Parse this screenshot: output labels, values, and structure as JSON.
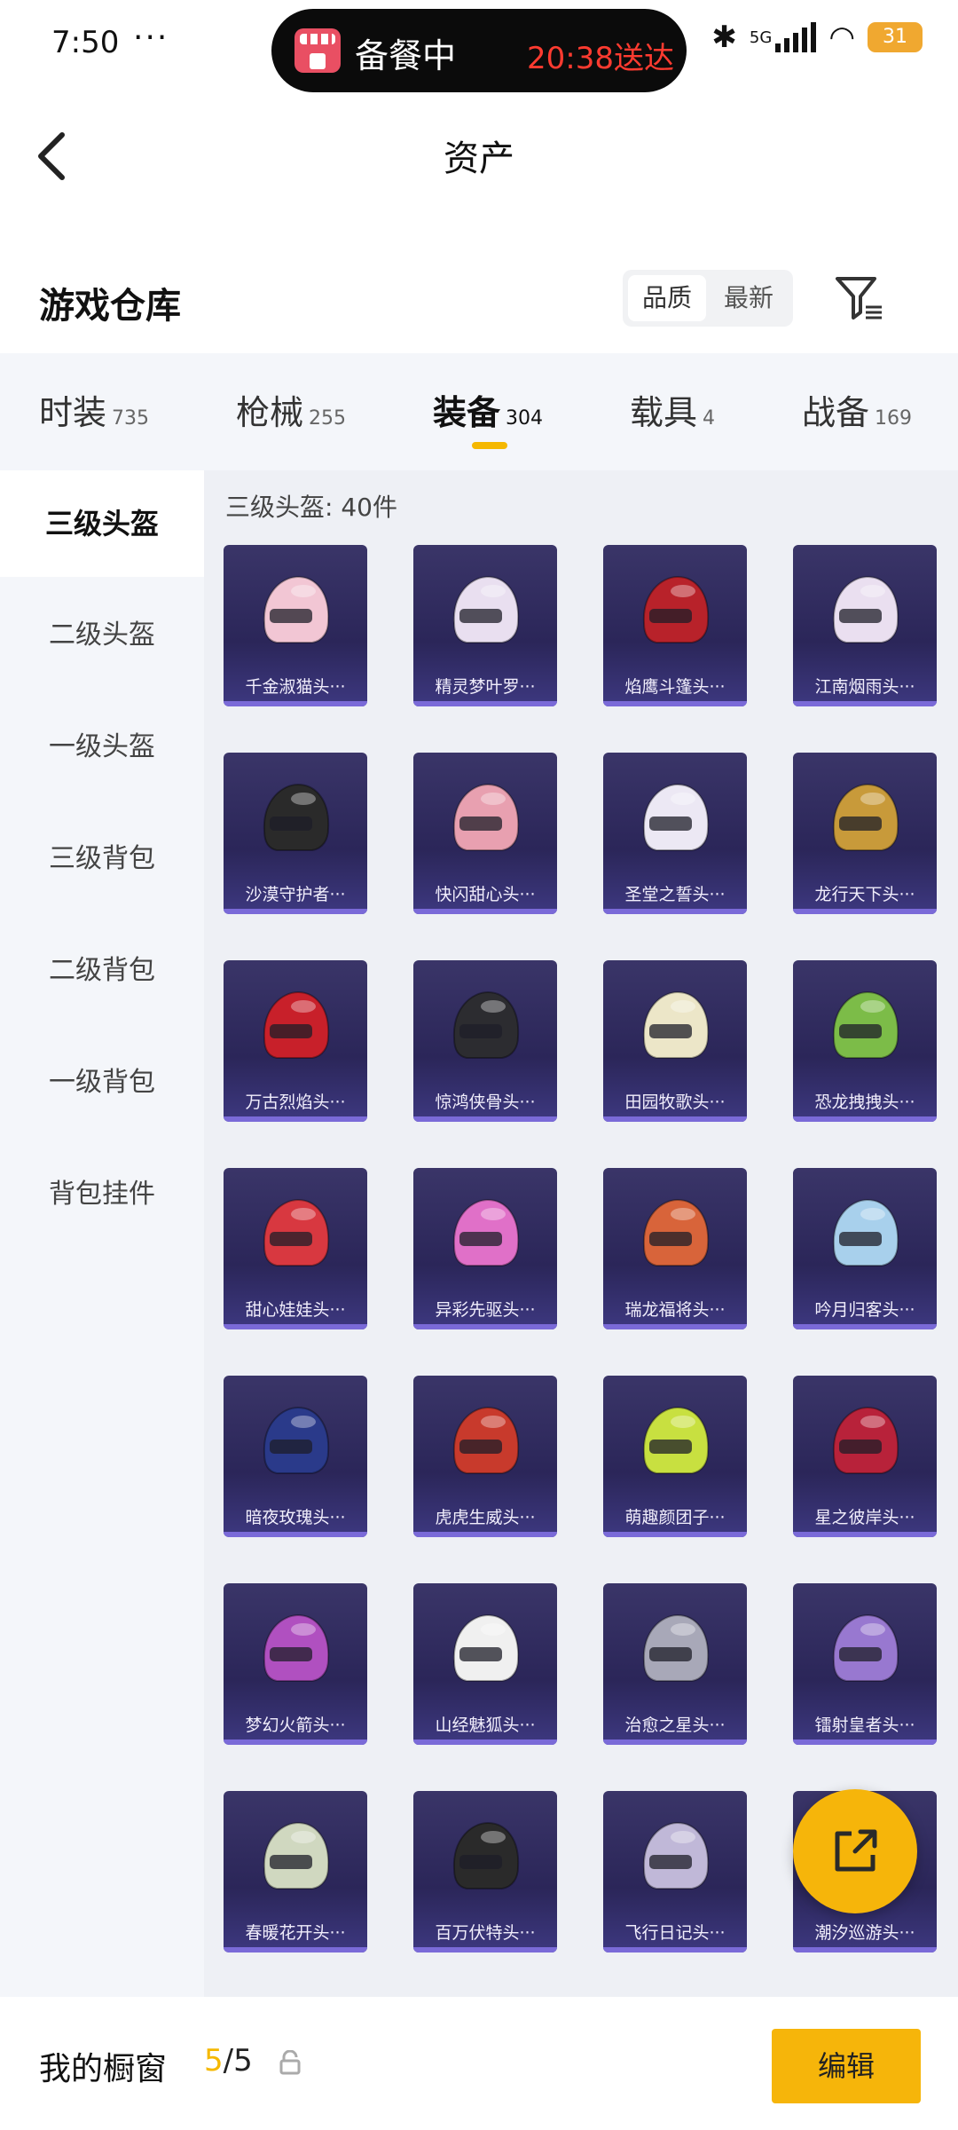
{
  "status_bar": {
    "time": "7:50",
    "dots": "···",
    "island_text": "备餐中",
    "island_time": "20:38送达",
    "network": "5G",
    "battery": "31"
  },
  "nav": {
    "title": "资产"
  },
  "header": {
    "title": "游戏仓库",
    "sort_quality": "品质",
    "sort_newest": "最新"
  },
  "tabs": [
    {
      "label": "时装",
      "count": "735"
    },
    {
      "label": "枪械",
      "count": "255"
    },
    {
      "label": "装备",
      "count": "304"
    },
    {
      "label": "载具",
      "count": "4"
    },
    {
      "label": "战备",
      "count": "169"
    }
  ],
  "sidebar": [
    {
      "label": "三级头盔"
    },
    {
      "label": "二级头盔"
    },
    {
      "label": "一级头盔"
    },
    {
      "label": "三级背包"
    },
    {
      "label": "二级背包"
    },
    {
      "label": "一级背包"
    },
    {
      "label": "背包挂件"
    }
  ],
  "subcat_count": "三级头盔: 40件",
  "items": [
    {
      "name": "千金淑猫头···",
      "color": "#f2c6d4"
    },
    {
      "name": "精灵梦叶罗···",
      "color": "#e9dff0"
    },
    {
      "name": "焰鹰斗篷头···",
      "color": "#b8222a"
    },
    {
      "name": "江南烟雨头···",
      "color": "#eadff0"
    },
    {
      "name": "沙漠守护者···",
      "color": "#2a2a2a"
    },
    {
      "name": "快闪甜心头···",
      "color": "#e8a0b0"
    },
    {
      "name": "圣堂之誓头···",
      "color": "#ece8f4"
    },
    {
      "name": "龙行天下头···",
      "color": "#c89a3a"
    },
    {
      "name": "万古烈焰头···",
      "color": "#c8202a"
    },
    {
      "name": "惊鸿侠骨头···",
      "color": "#2c2c30"
    },
    {
      "name": "田园牧歌头···",
      "color": "#ece6c8"
    },
    {
      "name": "恐龙拽拽头···",
      "color": "#7cbc48"
    },
    {
      "name": "甜心娃娃头···",
      "color": "#d83840"
    },
    {
      "name": "异彩先驱头···",
      "color": "#e070c8"
    },
    {
      "name": "瑞龙福将头···",
      "color": "#d8643a"
    },
    {
      "name": "吟月归客头···",
      "color": "#a8d0ec"
    },
    {
      "name": "暗夜玫瑰头···",
      "color": "#2a3a8a"
    },
    {
      "name": "虎虎生威头···",
      "color": "#c83a2c"
    },
    {
      "name": "萌趣颜团子···",
      "color": "#c8e040"
    },
    {
      "name": "星之彼岸头···",
      "color": "#b8223a"
    },
    {
      "name": "梦幻火箭头···",
      "color": "#b050c0"
    },
    {
      "name": "山经魅狐头···",
      "color": "#f0f0f0"
    },
    {
      "name": "治愈之星头···",
      "color": "#a8a8b8"
    },
    {
      "name": "镭射皇者头···",
      "color": "#9878d0"
    },
    {
      "name": "春暖花开头···",
      "color": "#d0d8c0"
    },
    {
      "name": "百万伏特头···",
      "color": "#2a2a2a"
    },
    {
      "name": "飞行日记头···",
      "color": "#c0b8d8"
    },
    {
      "name": "潮汐巡游头···",
      "color": "#a0a0c8"
    }
  ],
  "bottom": {
    "showcase_label": "我的橱窗",
    "showcase_current": "5",
    "showcase_total": "/5",
    "edit_label": "编辑"
  },
  "colors": {
    "accent": "#f6b50a",
    "card_bg": "#2b2659"
  }
}
